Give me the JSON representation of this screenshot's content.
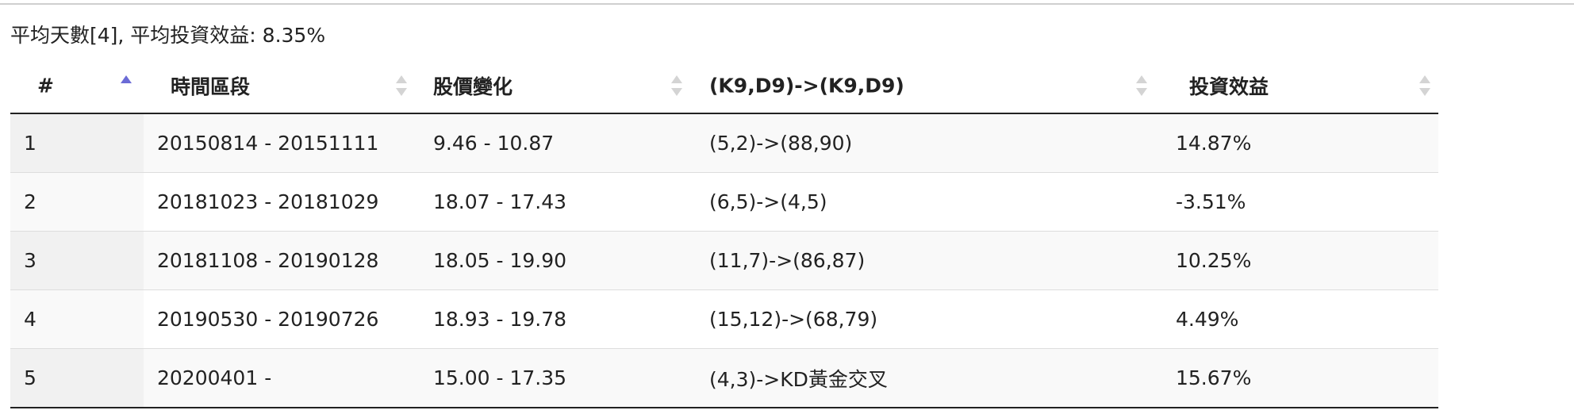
{
  "summary": "平均天數[4], 平均投資效益: 8.35%",
  "table": {
    "headers": [
      {
        "label": "#",
        "sort": "asc"
      },
      {
        "label": "時間區段",
        "sort": "none"
      },
      {
        "label": "股價變化",
        "sort": "none"
      },
      {
        "label": "(K9,D9)->(K9,D9)",
        "sort": "none"
      },
      {
        "label": "投資效益",
        "sort": "none"
      }
    ],
    "rows": [
      [
        "1",
        "20150814 - 20151111",
        "9.46 - 10.87",
        "(5,2)->(88,90)",
        "14.87%"
      ],
      [
        "2",
        "20181023 - 20181029",
        "18.07 - 17.43",
        "(6,5)->(4,5)",
        "-3.51%"
      ],
      [
        "3",
        "20181108 - 20190128",
        "18.05 - 19.90",
        "(11,7)->(86,87)",
        "10.25%"
      ],
      [
        "4",
        "20190530 - 20190726",
        "18.93 - 19.78",
        "(15,12)->(68,79)",
        "4.49%"
      ],
      [
        "5",
        "20200401 -",
        "15.00 - 17.35",
        "(4,3)->KD黃金交叉",
        "15.67%"
      ]
    ]
  },
  "colors": {
    "sort_active": "#6b6bd6",
    "sort_inactive": "#d4d4d4",
    "sorted_column_bg": "#f1f1f1"
  }
}
